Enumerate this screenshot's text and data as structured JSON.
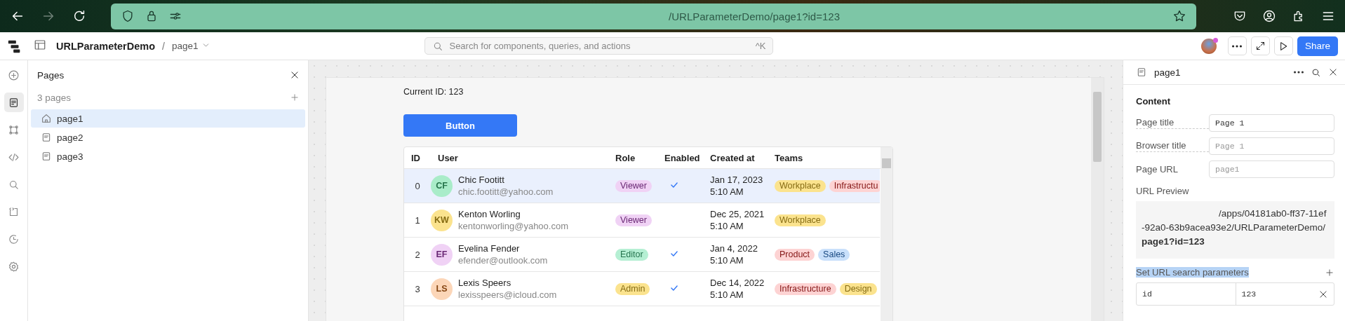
{
  "browser": {
    "url_text": "/URLParameterDemo/page1?id=123"
  },
  "header": {
    "app_name": "URLParameterDemo",
    "separator": "/",
    "page": "page1",
    "search_placeholder": "Search for components, queries, and actions",
    "search_shortcut": "^K",
    "share_label": "Share"
  },
  "rail": [
    {
      "kind": "add",
      "selected": false
    },
    {
      "kind": "pages",
      "selected": true
    },
    {
      "kind": "components",
      "selected": false
    },
    {
      "kind": "code",
      "selected": false
    },
    {
      "kind": "search",
      "selected": false
    },
    {
      "kind": "state",
      "selected": false
    },
    {
      "kind": "history",
      "selected": false
    },
    {
      "kind": "settings",
      "selected": false
    }
  ],
  "pages_panel": {
    "title": "Pages",
    "count": "3 pages",
    "pages": [
      {
        "label": "page1",
        "kind": "home",
        "selected": true
      },
      {
        "label": "page2",
        "kind": "page",
        "selected": false
      },
      {
        "label": "page3",
        "kind": "page",
        "selected": false
      }
    ]
  },
  "canvas": {
    "current_id": "Current ID: 123",
    "button": "Button",
    "table": {
      "columns": [
        "ID",
        "User",
        "Role",
        "Enabled",
        "Created at",
        "Teams"
      ],
      "rows": [
        {
          "id": "0",
          "avatar": {
            "initials": "CF",
            "color": "#a9ecc9"
          },
          "name": "Chic Footitt",
          "email": "chic.footitt@yahoo.com",
          "role": {
            "label": "Viewer",
            "color": "#f0d2f5"
          },
          "enabled": true,
          "created_date": "Jan 17, 2023",
          "created_time": "5:10 AM",
          "teams": [
            {
              "label": "Workplace",
              "color": "#fbe38e"
            },
            {
              "label": "Infrastructu",
              "color": "#fdd3d3"
            }
          ],
          "selected": true
        },
        {
          "id": "1",
          "avatar": {
            "initials": "KW",
            "color": "#fbe38e"
          },
          "name": "Kenton Worling",
          "email": "kentonworling@yahoo.com",
          "role": {
            "label": "Viewer",
            "color": "#f0d2f5"
          },
          "enabled": false,
          "created_date": "Dec 25, 2021",
          "created_time": "5:10 AM",
          "teams": [
            {
              "label": "Workplace",
              "color": "#fbe38e"
            }
          ],
          "selected": false
        },
        {
          "id": "2",
          "avatar": {
            "initials": "EF",
            "color": "#f0d2f5"
          },
          "name": "Evelina Fender",
          "email": "efender@outlook.com",
          "role": {
            "label": "Editor",
            "color": "#b5efd3"
          },
          "enabled": true,
          "created_date": "Jan 4, 2022",
          "created_time": "5:10 AM",
          "teams": [
            {
              "label": "Product",
              "color": "#fdd3d3"
            },
            {
              "label": "Sales",
              "color": "#c9e0fb"
            }
          ],
          "selected": false
        },
        {
          "id": "3",
          "avatar": {
            "initials": "LS",
            "color": "#fcd6b8"
          },
          "name": "Lexis Speers",
          "email": "lexisspeers@icloud.com",
          "role": {
            "label": "Admin",
            "color": "#fbe38e"
          },
          "enabled": true,
          "created_date": "Dec 14, 2022",
          "created_time": "5:10 AM",
          "teams": [
            {
              "label": "Infrastructure",
              "color": "#fdd3d3"
            },
            {
              "label": "Design",
              "color": "#fbe38e"
            }
          ],
          "selected": false
        }
      ]
    }
  },
  "inspector": {
    "title": "page1",
    "section": "Content",
    "fields": [
      {
        "label": "Page title",
        "value": "Page 1"
      },
      {
        "label": "Browser title",
        "placeholder": "Page 1"
      },
      {
        "label": "Page URL",
        "placeholder": "page1"
      }
    ],
    "preview_label": "URL Preview",
    "preview_url": "/apps/04181ab0-ff37-11ef-92a0-63b9acea93e2/URLParameterDemo/**page1?id=123**",
    "params_label": "Set URL search parameters",
    "params_highlighted": true,
    "params": [
      {
        "key": "id",
        "value": "123"
      }
    ]
  }
}
